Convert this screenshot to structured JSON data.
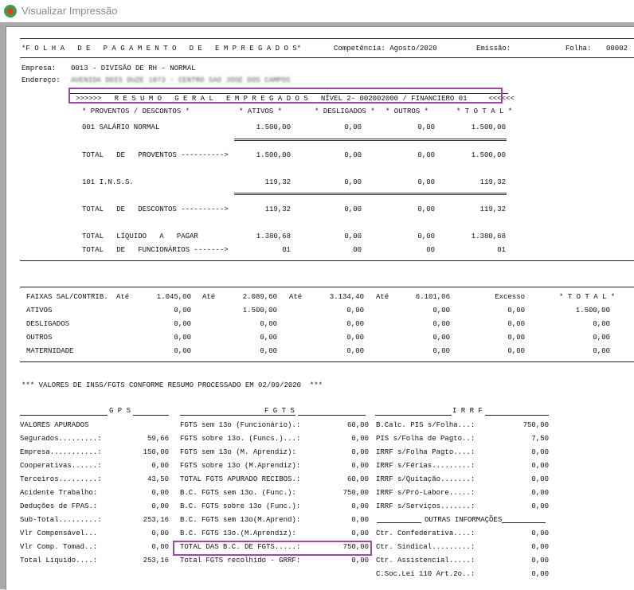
{
  "window": {
    "title": "Visualizar Impressão"
  },
  "header": {
    "title": "*F O L H A   D E   P A G A M E N T O   D E   E M P R E G A D O S*",
    "competencia": "Competência: Agosto/2020",
    "emissao": "Emissão:",
    "folha_label": "Folha:",
    "folha_num": "00002",
    "empresa_label": "Empresa:",
    "empresa_value": "0013 - DIVISÃO DE RH - NORMAL",
    "endereco_label": "Endereço:",
    "endereco_value": "AVENIDA DOIS DUZE 1873 - CENTRO SAO JOSE DOS CAMPOS"
  },
  "resumo": {
    "banner": ">>>>>>   R E S U M O   G E R A L   E M P R E G A D O S   NÍVEL 2- 002002000 / FINANCIERO 01     <<<<<<",
    "col_headers": [
      "* PROVENTOS / DESCONTOS *",
      "* ATIVOS *",
      "* DESLIGADOS *",
      "* OUTROS *",
      "* T O T A L *"
    ],
    "rows": [
      {
        "label": "001 SALÁRIO NORMAL",
        "ativos": "1.500,00",
        "desligados": "0,00",
        "outros": "0,00",
        "total": "1.500,00"
      },
      {
        "label": "TOTAL   DE   PROVENTOS ---------->",
        "ativos": "1.500,00",
        "desligados": "0,00",
        "outros": "0,00",
        "total": "1.500,00"
      },
      {
        "label": "101 I.N.S.S.",
        "ativos": "119,32",
        "desligados": "0,00",
        "outros": "0,00",
        "total": "119,32"
      },
      {
        "label": "TOTAL   DE   DESCONTOS ---------->",
        "ativos": "119,32",
        "desligados": "0,00",
        "outros": "0,00",
        "total": "119,32"
      },
      {
        "label": "TOTAL   LÍQUIDO   A   PAGAR",
        "ativos": "1.380,68",
        "desligados": "0,00",
        "outros": "0,00",
        "total": "1.380,68"
      },
      {
        "label": "TOTAL   DE   FUNCIONÁRIOS ------->",
        "ativos": "01",
        "desligados": "00",
        "outros": "00",
        "total": "01"
      }
    ]
  },
  "faixas": {
    "header": {
      "label": "FAIXAS SAL/CONTRIB.",
      "ate": "Até",
      "v1": "1.045,00",
      "v2": "2.089,60",
      "v3": "3.134,40",
      "v4": "6.101,06",
      "excesso": "Excesso",
      "total": "* T O T A L *"
    },
    "rows": [
      {
        "label": "ATIVOS",
        "c1": "0,00",
        "c2": "1.500,00",
        "c3": "0,00",
        "c4": "0,00",
        "c5": "0,00",
        "total": "1.500,00"
      },
      {
        "label": "DESLIGADOS",
        "c1": "0,00",
        "c2": "0,00",
        "c3": "0,00",
        "c4": "0,00",
        "c5": "0,00",
        "total": "0,00"
      },
      {
        "label": "OUTROS",
        "c1": "0,00",
        "c2": "0,00",
        "c3": "0,00",
        "c4": "0,00",
        "c5": "0,00",
        "total": "0,00"
      },
      {
        "label": "MATERNIDADE",
        "c1": "0,00",
        "c2": "0,00",
        "c3": "0,00",
        "c4": "0,00",
        "c5": "0,00",
        "total": "0,00"
      }
    ]
  },
  "valores_title": "*** VALORES DE INSS/FGTS CONFORME RESUMO PROCESSADO EM 02/09/2020  ***",
  "gps": {
    "header": "G P S",
    "subheader": "VALORES APURADOS",
    "rows": [
      {
        "label": "Segurados.........:",
        "value": "59,66"
      },
      {
        "label": "Empresa...........:",
        "value": "150,00"
      },
      {
        "label": "Cooperativas......:",
        "value": "0,00"
      },
      {
        "label": "Terceiros.........:",
        "value": "43,50"
      },
      {
        "label": "Acidente Trabalho:",
        "value": "0,00"
      },
      {
        "label": "Deduções de FPAS.:",
        "value": "0,00"
      },
      {
        "label": "Sub-Total.........:",
        "value": "253,16"
      },
      {
        "label": "Vlr Compensável...",
        "value": "0,00"
      },
      {
        "label": "Vlr Comp. Tomad..:",
        "value": "0,00"
      },
      {
        "label": "Total Líquido....:",
        "value": "253,16"
      }
    ]
  },
  "fgts": {
    "header": "F G T S",
    "rows": [
      {
        "label": "FGTS sem 13o (Funcionário).:",
        "value": "60,00"
      },
      {
        "label": "FGTS sobre 13o. (Funcs.)...:",
        "value": "0,00"
      },
      {
        "label": "FGTS sem 13o (M. Aprendiz):",
        "value": "0,00"
      },
      {
        "label": "FGTS sobre 13o (M.Aprendiz):",
        "value": "0,00"
      },
      {
        "label": "TOTAL FGTS APURADO RECIBOS.:",
        "value": "60,00"
      },
      {
        "label": "B.C. FGTS sem 13o. (Func.):",
        "value": "750,00"
      },
      {
        "label": "B.C. FGTS sobre 13o (Func.):",
        "value": "0,00"
      },
      {
        "label": "B.C. FGTS sem 13o(M.Aprend):",
        "value": "0,00"
      },
      {
        "label": "B.C. FGTS 13o.(M.Aprendiz):",
        "value": "0,00"
      },
      {
        "label": "TOTAL DAS B.C. DE FGTS.....:",
        "value": "750,00"
      },
      {
        "label": "Total FGTS recolhido - GRRF:",
        "value": "0,00"
      }
    ]
  },
  "irrf": {
    "header": "I R R F",
    "rows": [
      {
        "label": "B.Calc. PIS s/Folha...:",
        "value": "750,00"
      },
      {
        "label": "PIS s/Folha de Pagto..:",
        "value": "7,50"
      },
      {
        "label": "IRRF s/Folha Pagto....:",
        "value": "0,00"
      },
      {
        "label": "IRRF s/Férias.........:",
        "value": "0,00"
      },
      {
        "label": "IRRF s/Quitação.......:",
        "value": "0,00"
      },
      {
        "label": "IRRF s/Pró-Labore.....:",
        "value": "0,00"
      },
      {
        "label": "IRRF s/Serviços.......:",
        "value": "0,00"
      }
    ],
    "outras_header": "OUTRAS INFORMAÇÕES",
    "outras_rows": [
      {
        "label": "Ctr. Confederativa....:",
        "value": "0,00"
      },
      {
        "label": "Ctr. Sindical.........:",
        "value": "0,00"
      },
      {
        "label": "Ctr. Assistencial.....:",
        "value": "0,00"
      },
      {
        "label": "C.Soc.Lei 110 Art.2o..:",
        "value": "0,00"
      }
    ]
  },
  "colors": {
    "highlight": "#9a4aa0"
  }
}
